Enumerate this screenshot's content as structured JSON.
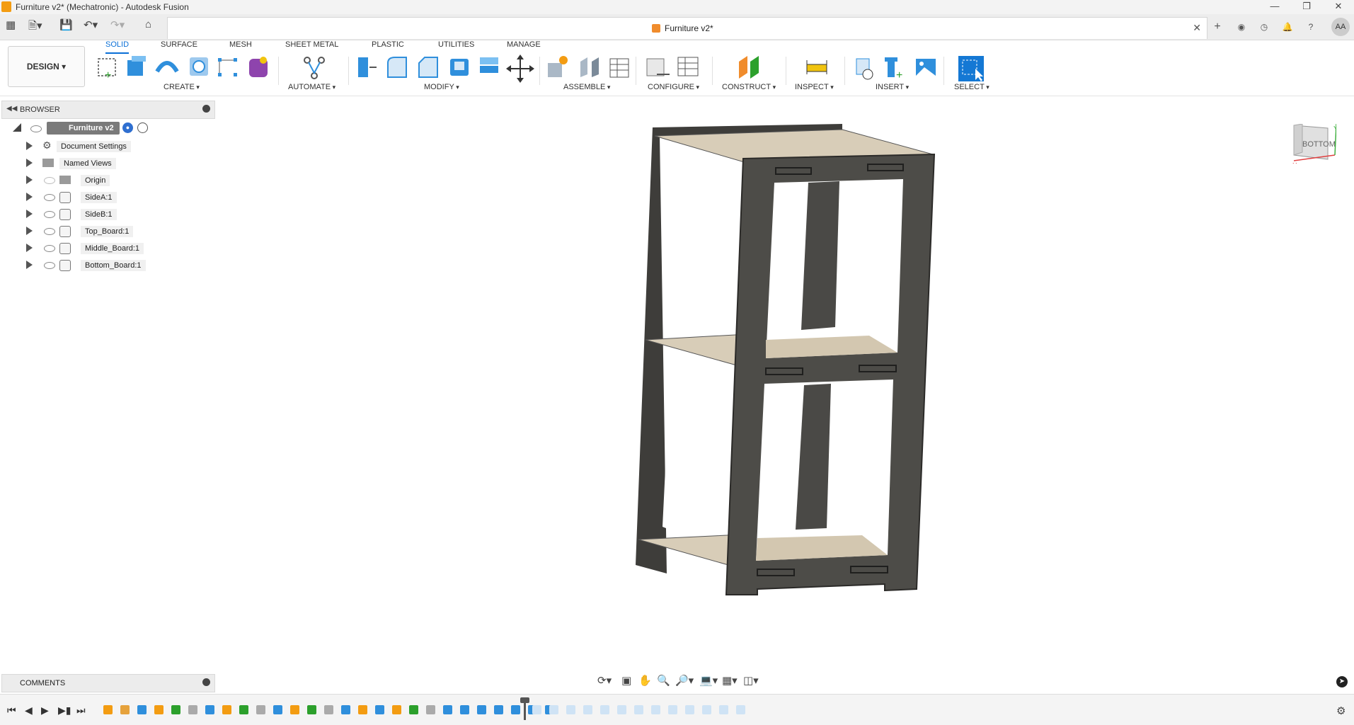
{
  "window": {
    "title": "Furniture v2* (Mechatronic) - Autodesk Fusion"
  },
  "document_tab": {
    "name": "Furniture v2*"
  },
  "user": {
    "initials": "AA"
  },
  "workspace": {
    "label": "DESIGN"
  },
  "toolbar": {
    "tabs": [
      {
        "label": "SOLID",
        "active": true
      },
      {
        "label": "SURFACE"
      },
      {
        "label": "MESH"
      },
      {
        "label": "SHEET METAL"
      },
      {
        "label": "PLASTIC"
      },
      {
        "label": "UTILITIES"
      },
      {
        "label": "MANAGE"
      }
    ],
    "groups": [
      "CREATE",
      "AUTOMATE",
      "MODIFY",
      "ASSEMBLE",
      "CONFIGURE",
      "CONSTRUCT",
      "INSPECT",
      "INSERT",
      "SELECT"
    ]
  },
  "browser": {
    "title": "BROWSER",
    "root": "Furniture v2",
    "items": [
      {
        "label": "Document Settings",
        "icon": "gear-icon"
      },
      {
        "label": "Named Views",
        "icon": "folder-icon"
      },
      {
        "label": "Origin",
        "icon": "folder-icon"
      },
      {
        "label": "SideA:1",
        "icon": "component-icon"
      },
      {
        "label": "SideB:1",
        "icon": "component-icon"
      },
      {
        "label": "Top_Board:1",
        "icon": "component-icon"
      },
      {
        "label": "Middle_Board:1",
        "icon": "component-icon"
      },
      {
        "label": "Bottom_Board:1",
        "icon": "component-icon"
      }
    ]
  },
  "comments": {
    "title": "COMMENTS"
  },
  "viewcube": {
    "face": "BOTTOM",
    "axis_x": "X",
    "axis_y": "Y"
  },
  "colors": {
    "accent": "#0a6fd6",
    "board": "#d8cdb8",
    "side": "#4d4c48"
  }
}
